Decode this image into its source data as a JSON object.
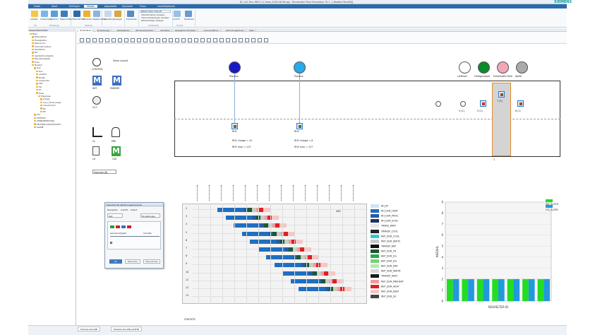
{
  "window": {
    "title": "[R_L03_Tecn INFL1 LC-Hubs_2018-06-06.spp - Tecnomatix Plant Simulation 15.1 - [.Modelle.Tecn$N]]",
    "brand": "SIEMENS"
  },
  "menu": {
    "tabs": [
      "Datei",
      "Start",
      "Einfügen",
      "Modell",
      "Jobpalette",
      "Symbole",
      "Fluss",
      "Laufzeitplanen"
    ],
    "active_index": 3
  },
  "ribbon": {
    "buttons": [
      "Laufzeit",
      "Lokale Kopie",
      "Kopieren",
      "Eigenschaften",
      "Übernehmen",
      "Verbinden",
      "Objekte wählen",
      "Verwaltung",
      "Anzeigen",
      "Exportieren",
      "Ansicht",
      "Dashboard"
    ],
    "groups": [
      "Ort",
      "Werkzeuge",
      "Attribute",
      "Sichtbarkeit",
      "Fenster"
    ],
    "checks": [
      "Überlaufmarken anzeigen",
      "Unterverzweigungen anzeigen",
      "Referenzzeiger anzeigen"
    ],
    "search_placeholder": "Befehl finden (Strg+E)"
  },
  "left_panel": {
    "title": "Klassenbibliothek",
    "items": [
      "Basis",
      "Materialfluss",
      "Flüssigkeiten",
      "Ressourcen",
      "Informationsfluss",
      "Oberfläche",
      "Mrs",
      "Applikationsobjekte",
      "Benutzerobjekte",
      "Tools",
      "Modelle",
      "Tecn",
      "Tecn",
      "Laufzeit",
      "Modell",
      "Aussenrohr",
      "TRG",
      "HG",
      "ST",
      "Posts",
      "Ereignisse",
      "Anlage",
      "Cony_Fluids_Single",
      "CraneControl",
      "Mt",
      "MF",
      "Prof",
      "STATISTIC",
      "LEIBELBEWEGUNG",
      "ZEITVERLAUFAUSTAUSCH",
      "TestMB"
    ]
  },
  "doc_tabs": [
    "Modellübers",
    "Einstellungen",
    "Wertetabelle",
    "Wochenzeitverlauf",
    "Userdaten",
    "Bewegliche Einheiten",
    "Linienverfahren",
    "Verbindungsbbaum",
    "Tests"
  ],
  "canvas": {
    "side_items": [
      {
        "label": "CONTROL"
      },
      {
        "label": "INIT"
      },
      {
        "label": "ENDSIM"
      },
      {
        "label": "CCC"
      },
      {
        "label": "CL"
      },
      {
        "label": "PRE"
      },
      {
        "label": "LK"
      },
      {
        "label": "OLE"
      }
    ],
    "show_layout": "Show Layout",
    "top_nodes": [
      "Prozess",
      "Prozess",
      "Lieferort",
      "Fertigprodukt",
      "Fehlerhafte Teile",
      "Abfall"
    ],
    "rh1": {
      "label": "RH1",
      "charge": "RH1 charge = 41",
      "max": "RH1 max = 113"
    },
    "rh2": {
      "label": "RH2",
      "charge": "RH2 charge = 8",
      "max": "RH2 max = 127"
    },
    "station_values": [
      "5 (1)",
      "5 (1)",
      "1 (1)",
      "7 (5)",
      "6 (1)"
    ],
    "dropdown": "Usecase (6)",
    "bottom_label": "1"
  },
  "gantt": {
    "rows": [
      "2",
      "3",
      "4",
      "5",
      "6",
      "7",
      "8",
      "9",
      "10",
      "11",
      "12",
      "13"
    ],
    "end_label": "#67",
    "bottom_label": "STATISTIC"
  },
  "legend": {
    "items": [
      {
        "label": "RH_IN",
        "color": "#cfe4f4"
      },
      {
        "label": "RH_DUR_HEAT",
        "color": "#1f6fbf"
      },
      {
        "label": "RH_DUR_PROC",
        "color": "#2b5aa0"
      },
      {
        "label": "RH_DUR_SOUL",
        "color": "#1a3468"
      },
      {
        "label": "TRANS_WAIT",
        "color": "#e6e6e6"
      },
      {
        "label": "TRANSP_COOL",
        "color": "#222222"
      },
      {
        "label": "REP_DUR_COOL",
        "color": "#35c6d8"
      },
      {
        "label": "REP_DUR_WAITC",
        "color": "#c9c9c9"
      },
      {
        "label": "TRANSP_REP",
        "color": "#111111"
      },
      {
        "label": "REP_DUR_TR",
        "color": "#1b5b2e"
      },
      {
        "label": "REP_DUR_UG",
        "color": "#2aa84a"
      },
      {
        "label": "REP_DUR_DG",
        "color": "#7ad17a"
      },
      {
        "label": "REP_DUR_DRY",
        "color": "#b8e6b0"
      },
      {
        "label": "REP_DUR_WAITR",
        "color": "#d7d7d7"
      },
      {
        "label": "TRANSP_HEAT",
        "color": "#1a1a1a"
      },
      {
        "label": "REP_DUR_PREHEAT",
        "color": "#f29a9a"
      },
      {
        "label": "REP_DUR_HEAT",
        "color": "#e02020"
      },
      {
        "label": "REP_DUR_KEEP",
        "color": "#f6c6c6"
      },
      {
        "label": "REP_DUR_SU",
        "color": "#444444"
      }
    ]
  },
  "chart_data": {
    "type": "bar",
    "categories": [
      "1",
      "2",
      "3",
      "4",
      "5",
      "6",
      "7"
    ],
    "series": [
      {
        "name": "WS_ALTER",
        "values": [
          2,
          2,
          2,
          2,
          2,
          2,
          2
        ]
      },
      {
        "name": "OG_ALTER",
        "values": [
          2,
          2,
          2,
          2,
          2,
          2,
          2
        ]
      }
    ],
    "xlabel": "REHAELTER ID",
    "ylabel": "ANZAHL",
    "ylim": [
      0,
      9
    ],
    "yticks": [
      "0",
      "1",
      "2",
      "3",
      "4",
      "5",
      "6",
      "7",
      "8",
      "9"
    ],
    "colors": {
      "WS_ALTER": "#22dd22",
      "OG_ALTER": "#2299dd"
    }
  },
  "dialog": {
    "title": "Ubersicht Tecn$Fuhrungsstrumente",
    "tabs": [
      "Navigation",
      "Ansicht",
      "Ablauf"
    ],
    "field1": "Zeit",
    "field2": "Einstellungen",
    "field3": "Geschwindigkeit",
    "speed": "Schnitte",
    "ok": "OK",
    "cancel": "Abbrechen",
    "apply": "Übernehmen"
  },
  "bottom_tabs": [
    "Modelle.TecnNB",
    "Modelle.TecnNB_DASHB"
  ]
}
